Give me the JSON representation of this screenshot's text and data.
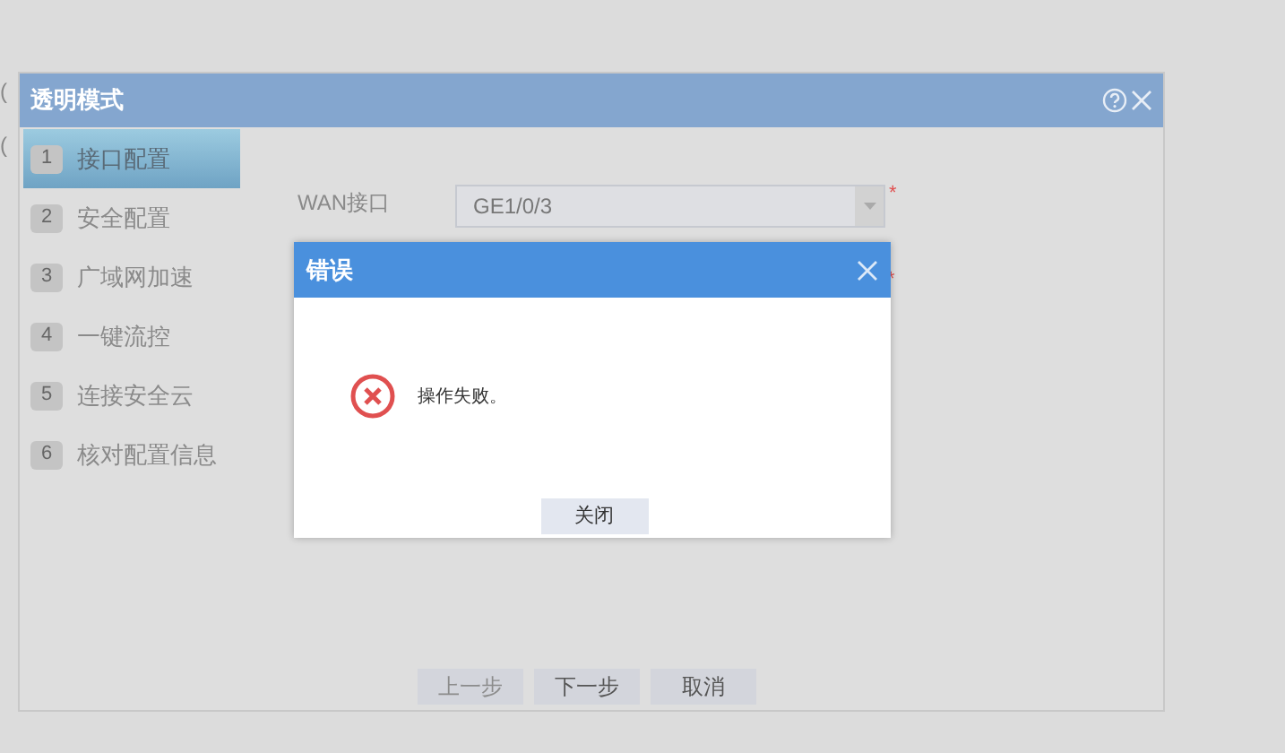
{
  "background_fragments": [
    "(",
    "("
  ],
  "wizard": {
    "title": "透明模式",
    "steps": [
      {
        "number": "1",
        "label": "接口配置",
        "selected": true
      },
      {
        "number": "2",
        "label": "安全配置",
        "selected": false
      },
      {
        "number": "3",
        "label": "广域网加速",
        "selected": false
      },
      {
        "number": "4",
        "label": "一键流控",
        "selected": false
      },
      {
        "number": "5",
        "label": "连接安全云",
        "selected": false
      },
      {
        "number": "6",
        "label": "核对配置信息",
        "selected": false
      }
    ],
    "fields": [
      {
        "label": "WAN接口",
        "value": "GE1/0/3",
        "required_mark": "*"
      },
      {
        "required_mark": "*"
      }
    ],
    "buttons": [
      {
        "label": "上一步",
        "disabled": true
      },
      {
        "label": "下一步",
        "disabled": false
      },
      {
        "label": "取消",
        "disabled": false
      }
    ]
  },
  "error_dialog": {
    "title": "错误",
    "message": "操作失败。",
    "button": "关闭"
  }
}
